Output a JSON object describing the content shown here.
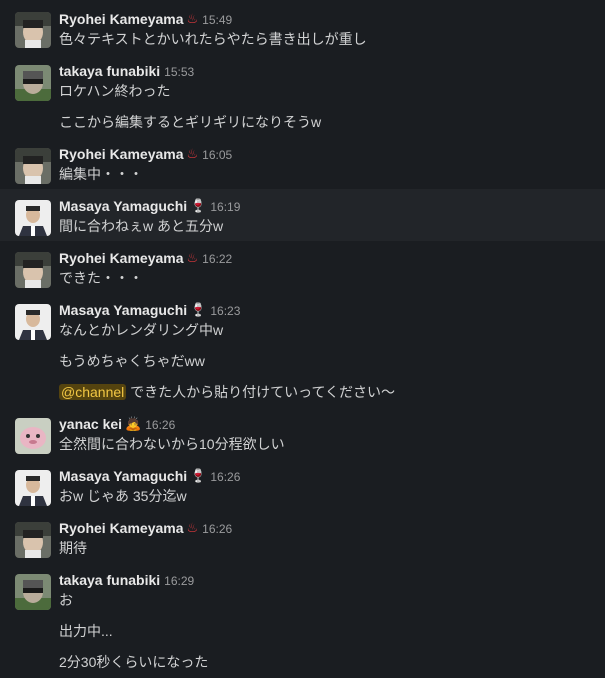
{
  "messages": [
    {
      "author": "Ryohei Kameyama",
      "status_emoji": "♨",
      "status_color": "#e0393e",
      "time": "15:49",
      "avatar": "avatar-ryohei",
      "lines": [
        "色々テキストとかいれたらやたら書き出しが重し"
      ]
    },
    {
      "author": "takaya funabiki",
      "status_emoji": "",
      "time": "15:53",
      "avatar": "avatar-takaya",
      "lines": [
        "ロケハン終わった",
        "ここから編集するとギリギリになりそうw"
      ]
    },
    {
      "author": "Ryohei Kameyama",
      "status_emoji": "♨",
      "status_color": "#e0393e",
      "time": "16:05",
      "avatar": "avatar-ryohei",
      "lines": [
        "編集中・・・"
      ]
    },
    {
      "author": "Masaya Yamaguchi",
      "status_emoji": "🍷",
      "status_color": "#c0323c",
      "time": "16:19",
      "avatar": "avatar-masaya",
      "lines": [
        "間に合わねぇw あと五分w"
      ]
    },
    {
      "author": "Ryohei Kameyama",
      "status_emoji": "♨",
      "status_color": "#e0393e",
      "time": "16:22",
      "avatar": "avatar-ryohei",
      "lines": [
        "できた・・・"
      ]
    },
    {
      "author": "Masaya Yamaguchi",
      "status_emoji": "🍷",
      "status_color": "#c0323c",
      "time": "16:23",
      "avatar": "avatar-masaya",
      "lines": [
        "なんとかレンダリング中w",
        "もうめちゃくちゃだww"
      ],
      "mention_line": {
        "mention": "@channel",
        "text": " できた人から貼り付けていってください〜"
      }
    },
    {
      "author": "yanac kei",
      "status_emoji": "🙇",
      "status_color": "#d9a07a",
      "time": "16:26",
      "avatar": "avatar-yanac",
      "lines": [
        "全然間に合わないから10分程欲しい"
      ]
    },
    {
      "author": "Masaya Yamaguchi",
      "status_emoji": "🍷",
      "status_color": "#c0323c",
      "time": "16:26",
      "avatar": "avatar-masaya",
      "lines": [
        "おw じゃあ 35分迄w"
      ]
    },
    {
      "author": "Ryohei Kameyama",
      "status_emoji": "♨",
      "status_color": "#e0393e",
      "time": "16:26",
      "avatar": "avatar-ryohei",
      "lines": [
        "期待"
      ]
    },
    {
      "author": "takaya funabiki",
      "status_emoji": "",
      "time": "16:29",
      "avatar": "avatar-takaya",
      "lines": [
        "お",
        "出力中...",
        "2分30秒くらいになった"
      ]
    }
  ],
  "colors": {
    "background": "#1a1d21",
    "hover_background": "#222529",
    "mention_background": "#54430f",
    "mention_text": "#f2c744"
  }
}
